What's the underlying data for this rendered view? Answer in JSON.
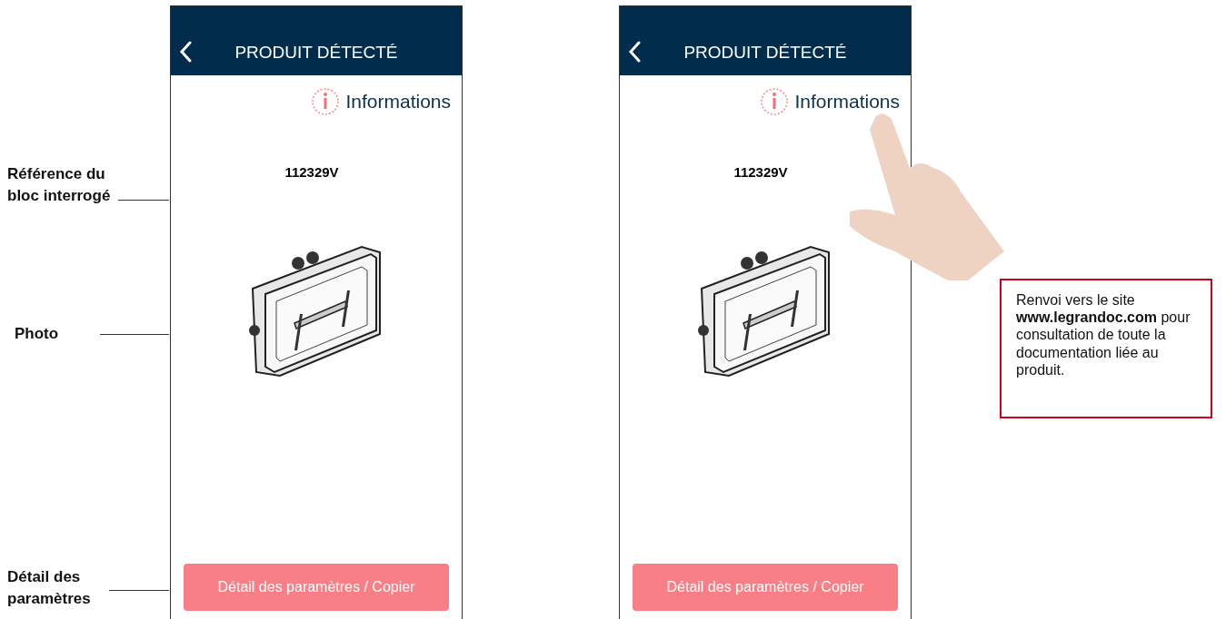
{
  "annotations": [
    {
      "text": "Référence du bloc interrogé"
    },
    {
      "text": "Photo"
    },
    {
      "text": "Détail des paramètres"
    }
  ],
  "screens": [
    {
      "title": "PRODUIT DÉTECTÉ",
      "info_link": "Informations",
      "reference": "112329V",
      "button": "Détail des paramètres / Copier",
      "touched": false
    },
    {
      "title": "PRODUIT DÉTECTÉ",
      "info_link": "Informations",
      "reference": "112329V",
      "button": "Détail des paramètres / Copier",
      "touched": true
    }
  ],
  "callout": {
    "text": "Renvoi vers le site **www.legrandoc.com** pour consultation de toute la documentation liée au produit."
  }
}
